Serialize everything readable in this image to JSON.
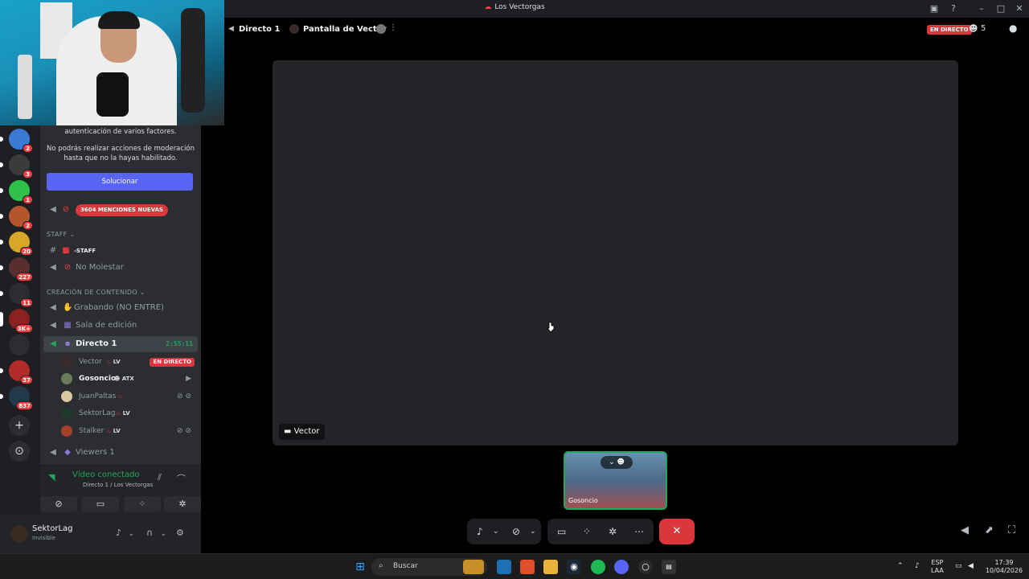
{
  "window": {
    "title": "Los Vectorgas"
  },
  "notice": {
    "line1": "autenticación de varios factores.",
    "line2": "No podrás realizar acciones de moderación",
    "line3": "hasta que no la hayas habilitado.",
    "button": "Solucionar"
  },
  "servers": [
    {
      "badge": "2"
    },
    {
      "badge": "3"
    },
    {
      "badge": "1"
    },
    {
      "badge": "2"
    },
    {
      "badge": "20"
    },
    {
      "badge": "227"
    },
    {
      "badge": "11"
    },
    {
      "badge": "3K+"
    },
    {
      "badge": ""
    },
    {
      "badge": "37"
    },
    {
      "badge": "837"
    }
  ],
  "channels": {
    "mentions": "3604 MENCIONES NUEVAS",
    "cat_staff": "STAFF",
    "staff_channel": "-STAFF",
    "no_molestar": "No Molestar",
    "cat_contenido": "CREACIÓN DE CONTENIDO",
    "grabando": "Grabando (NO ENTRE)",
    "sala": "Sala de edición",
    "directo": "Directo 1",
    "directo_timer": "2:55:11",
    "viewers": "Viewers 1"
  },
  "members": [
    {
      "name": "Vector",
      "tag": "LV",
      "live": "EN DIRECTO"
    },
    {
      "name": "Gosoncio",
      "tag": "ATX"
    },
    {
      "name": "JuanPaltas",
      "tag": ""
    },
    {
      "name": "SektorLag",
      "tag": "LV"
    },
    {
      "name": "Stalker",
      "tag": "LV"
    }
  ],
  "voice": {
    "status": "Vídeo conectado",
    "sub": "Directo 1 / Los Vectorgas"
  },
  "user": {
    "name": "SektorLag",
    "status": "Invisible"
  },
  "topbar": {
    "channel": "Directo 1",
    "screen": "Pantalla de Vector",
    "live": "EN DIRECTO",
    "count": "5"
  },
  "stage": {
    "streamer": "Vector"
  },
  "tile": {
    "name": "Gosoncio"
  },
  "taskbar": {
    "search": "Buscar",
    "lang1": "ESP",
    "lang2": "LAA",
    "time": "17:39",
    "date": "10/04/2026"
  },
  "colors": {
    "accent": "#5865f2",
    "live": "#da373c",
    "connected": "#23a55a"
  }
}
